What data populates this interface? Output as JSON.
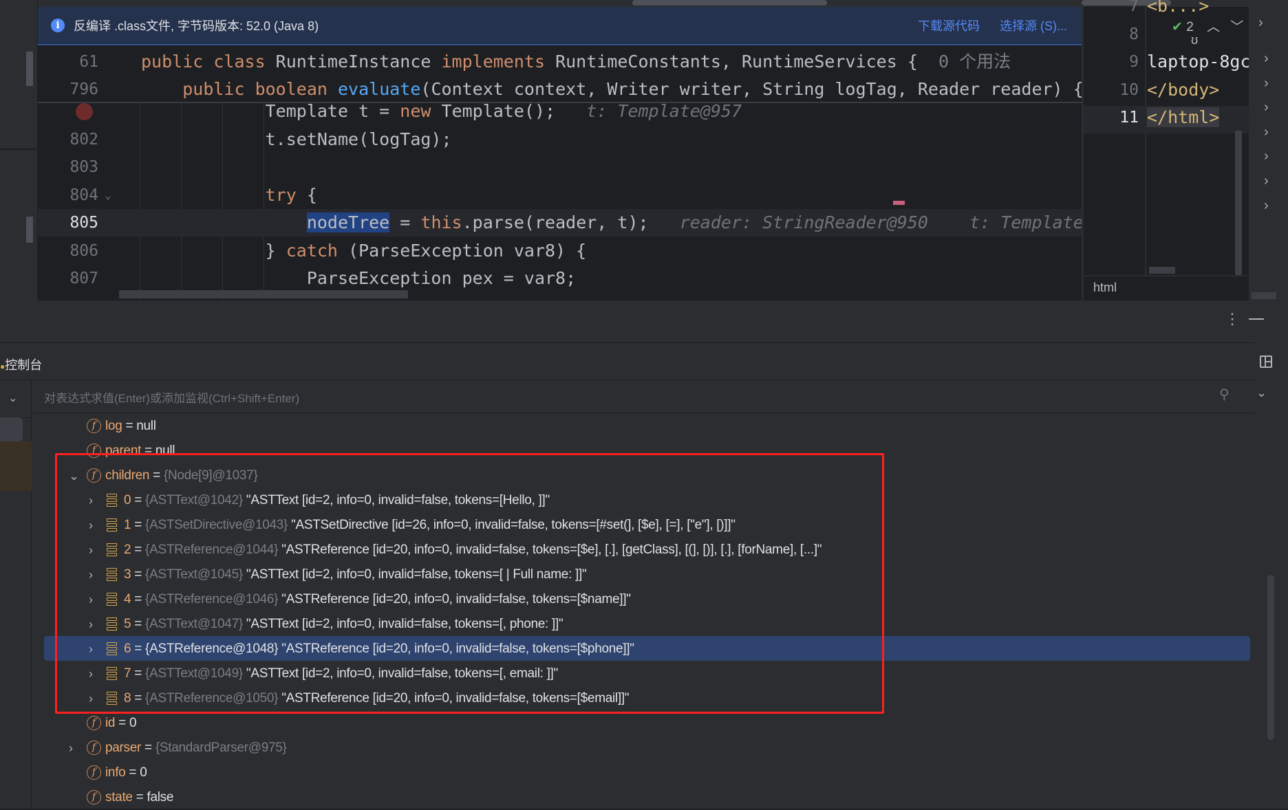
{
  "notification": {
    "icon": "info-icon",
    "message": "反编译 .class文件, 字节码版本: 52.0 (Java 8)",
    "download_source": "下载源代码",
    "choose_source": "选择源 (S)..."
  },
  "editor": {
    "sticky": [
      {
        "line": "61",
        "parts": [
          [
            "kw",
            "public class "
          ],
          [
            "",
            "RuntimeInstance "
          ],
          [
            "kw",
            "implements "
          ],
          [
            "",
            "RuntimeConstants, RuntimeServices {  "
          ],
          [
            "gr",
            "0 个用法"
          ]
        ]
      },
      {
        "line": "796",
        "parts": [
          [
            "",
            "    "
          ],
          [
            "kw",
            "public boolean "
          ],
          [
            "fn",
            "evaluate"
          ],
          [
            "",
            "(Context context, Writer writer, String logTag, Reader reader) {"
          ]
        ]
      }
    ],
    "lines": [
      {
        "line": "",
        "breakpoint": true,
        "parts": [
          [
            "",
            "            Template t = "
          ],
          [
            "kw",
            "new "
          ],
          [
            "",
            "Template();   "
          ],
          [
            "hint",
            "t: Template@957"
          ]
        ]
      },
      {
        "line": "802",
        "parts": [
          [
            "",
            "            t.setName(logTag);"
          ]
        ]
      },
      {
        "line": "803",
        "parts": []
      },
      {
        "line": "804",
        "fold": true,
        "parts": [
          [
            "",
            "            "
          ],
          [
            "kw",
            "try "
          ],
          [
            "",
            "{"
          ]
        ]
      },
      {
        "line": "805",
        "current": true,
        "parts": [
          [
            "",
            "                "
          ],
          [
            "sel",
            "nodeTree"
          ],
          [
            "",
            " = "
          ],
          [
            "kw",
            "this"
          ],
          [
            "",
            ".parse(reader, t);   "
          ],
          [
            "hint",
            "reader: StringReader@950    t: Template@"
          ]
        ]
      },
      {
        "line": "806",
        "parts": [
          [
            "",
            "            } "
          ],
          [
            "kw",
            "catch "
          ],
          [
            "",
            "(ParseException var8) {"
          ]
        ]
      },
      {
        "line": "807",
        "parts": [
          [
            "",
            "                ParseException pex = var8;"
          ]
        ]
      }
    ]
  },
  "preview": {
    "lines": [
      {
        "n": "7",
        "text": "<b...>"
      },
      {
        "n": "8",
        "text": ""
      },
      {
        "n": "9",
        "text": "laptop-8gc"
      },
      {
        "n": "10",
        "text": "</body>"
      },
      {
        "n": "11",
        "text": "</html>"
      }
    ],
    "inspection_count": "2",
    "status": "html"
  },
  "debug": {
    "console_tab": "控制台",
    "eval_placeholder": "对表达式求值(Enter)或添加监视(Ctrl+Shift+Enter)",
    "fields_top": [
      {
        "name": "log",
        "eq": " = ",
        "type": "",
        "value": "null"
      },
      {
        "name": "parent",
        "eq": " = ",
        "type": "",
        "value": "null"
      }
    ],
    "children": {
      "name": "children",
      "eq": " = ",
      "type": "{Node[9]@1037}"
    },
    "items": [
      {
        "idx": "0",
        "type": "{ASTText@1042}",
        "value": "\"ASTText [id=2, info=0, invalid=false, tokens=[Hello, ]]\""
      },
      {
        "idx": "1",
        "type": "{ASTSetDirective@1043}",
        "value": "\"ASTSetDirective [id=26, info=0, invalid=false, tokens=[#set(], [$e], [=], [\"e\"], [)]]\""
      },
      {
        "idx": "2",
        "type": "{ASTReference@1044}",
        "value": "\"ASTReference [id=20, info=0, invalid=false, tokens=[$e], [.], [getClass], [(], [)], [.], [forName], [...]\""
      },
      {
        "idx": "3",
        "type": "{ASTText@1045}",
        "value": "\"ASTText [id=2, info=0, invalid=false, tokens=[ | Full name: ]]\""
      },
      {
        "idx": "4",
        "type": "{ASTReference@1046}",
        "value": "\"ASTReference [id=20, info=0, invalid=false, tokens=[$name]]\""
      },
      {
        "idx": "5",
        "type": "{ASTText@1047}",
        "value": "\"ASTText [id=2, info=0, invalid=false, tokens=[, phone: ]]\""
      },
      {
        "idx": "6",
        "type": "{ASTReference@1048}",
        "value": "\"ASTReference [id=20, info=0, invalid=false, tokens=[$phone]]\"",
        "selected": true
      },
      {
        "idx": "7",
        "type": "{ASTText@1049}",
        "value": "\"ASTText [id=2, info=0, invalid=false, tokens=[, email: ]]\""
      },
      {
        "idx": "8",
        "type": "{ASTReference@1050}",
        "value": "\"ASTReference [id=20, info=0, invalid=false, tokens=[$email]]\""
      }
    ],
    "fields_bottom": [
      {
        "name": "id",
        "eq": " = ",
        "type": "",
        "value": "0"
      },
      {
        "name": "parser",
        "eq": " = ",
        "type": "{StandardParser@975}",
        "value": "",
        "expandable": true
      },
      {
        "name": "info",
        "eq": " = ",
        "type": "",
        "value": "0"
      },
      {
        "name": "state",
        "eq": " = ",
        "type": "",
        "value": "false"
      }
    ]
  },
  "colors": {
    "highlight_box": "#ff2020",
    "selection": "#2e436e",
    "keyword": "#cf8e6d",
    "method": "#56a8f5"
  }
}
